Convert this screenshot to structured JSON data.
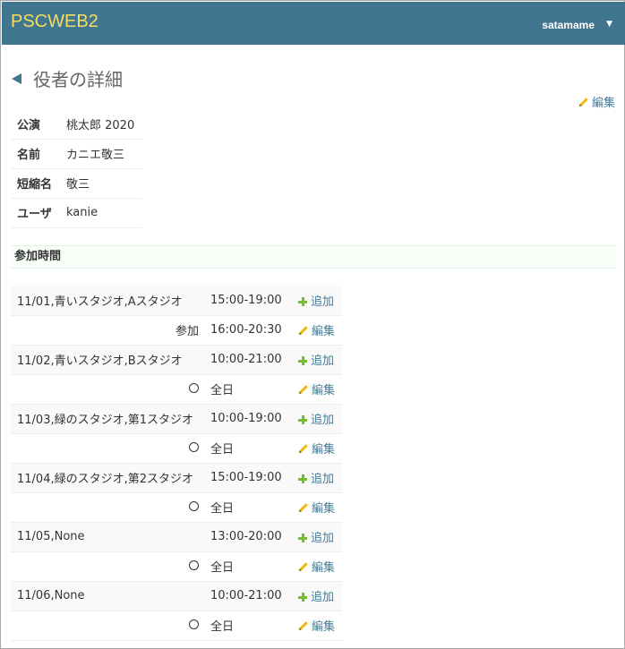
{
  "app": {
    "brand": "PSCWEB2",
    "user": "satamame",
    "caret": "▼"
  },
  "page": {
    "title": "役者の詳細",
    "edit_label": "編集"
  },
  "details": [
    {
      "key": "公演",
      "value": "桃太郎 2020"
    },
    {
      "key": "名前",
      "value": "カニエ敬三"
    },
    {
      "key": "短縮名",
      "value": "敬三"
    },
    {
      "key": "ユーザ",
      "value": "kanie"
    }
  ],
  "section": {
    "title": "参加時間"
  },
  "schedule": [
    {
      "label": "11/01,青いスタジオ,Aスタジオ",
      "time": "15:00-19:00",
      "action": "追加",
      "action_type": "add"
    },
    {
      "label": "参加",
      "time": "16:00-20:30",
      "action": "編集",
      "action_type": "edit"
    },
    {
      "label": "11/02,青いスタジオ,Bスタジオ",
      "time": "10:00-21:00",
      "action": "追加",
      "action_type": "add"
    },
    {
      "label": "〇",
      "time": "全日",
      "action": "編集",
      "action_type": "edit"
    },
    {
      "label": "11/03,緑のスタジオ,第1スタジオ",
      "time": "10:00-19:00",
      "action": "追加",
      "action_type": "add"
    },
    {
      "label": "〇",
      "time": "全日",
      "action": "編集",
      "action_type": "edit"
    },
    {
      "label": "11/04,緑のスタジオ,第2スタジオ",
      "time": "15:00-19:00",
      "action": "追加",
      "action_type": "add"
    },
    {
      "label": "〇",
      "time": "全日",
      "action": "編集",
      "action_type": "edit"
    },
    {
      "label": "11/05,None",
      "time": "13:00-20:00",
      "action": "追加",
      "action_type": "add"
    },
    {
      "label": "〇",
      "time": "全日",
      "action": "編集",
      "action_type": "edit"
    },
    {
      "label": "11/06,None",
      "time": "10:00-21:00",
      "action": "追加",
      "action_type": "add"
    },
    {
      "label": "〇",
      "time": "全日",
      "action": "編集",
      "action_type": "edit"
    }
  ],
  "colors": {
    "header": "#417690",
    "brand": "#f5dd5d",
    "link": "#447e9b",
    "add_icon": "#70bf2b",
    "edit_icon": "#efb80b"
  }
}
